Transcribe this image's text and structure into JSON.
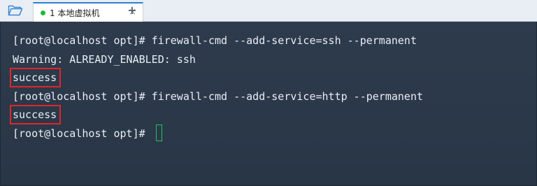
{
  "tabbar": {
    "open_icon": "folder-open-icon",
    "tab_label": "1 本地虚拟机",
    "tab_status_color": "#1dbb3e",
    "close_symbol": "×",
    "add_symbol": "+"
  },
  "terminal": {
    "lines": [
      "[root@localhost opt]# firewall-cmd --add-service=ssh --permanent",
      "Warning: ALREADY_ENABLED: ssh",
      "success",
      "[root@localhost opt]# firewall-cmd --add-service=http --permanent",
      "success",
      "[root@localhost opt]# "
    ],
    "highlight_color": "#e0262a",
    "background": "#2b3a4b",
    "cursor_color": "#22c55e"
  }
}
